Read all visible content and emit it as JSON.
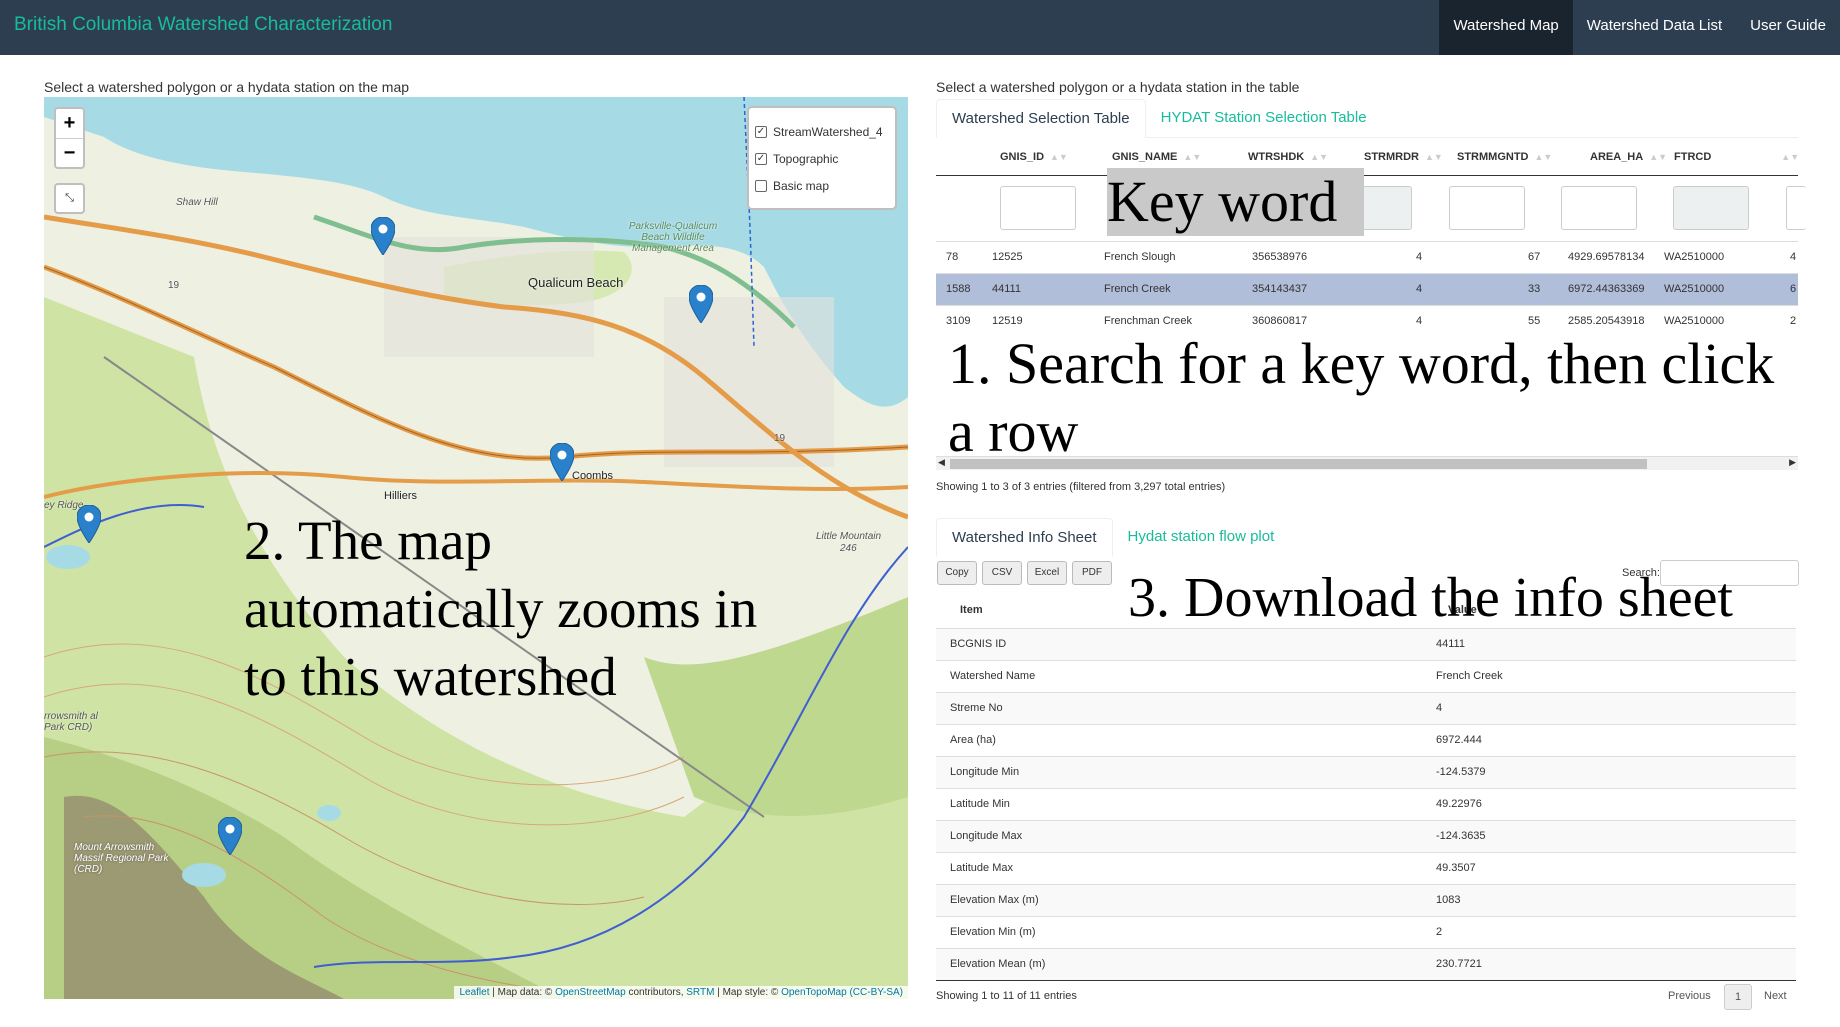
{
  "app": {
    "title": "British Columbia Watershed Characterization"
  },
  "nav": {
    "items": [
      "Watershed Map",
      "Watershed Data List",
      "User Guide"
    ]
  },
  "left": {
    "caption": "Select a watershed polygon or a hydata station on the map"
  },
  "right": {
    "caption": "Select a watershed polygon or a hydata station in the table"
  },
  "map": {
    "zoom_in": "+",
    "zoom_out": "−",
    "fullscreen": "⤡",
    "layers": [
      {
        "label": "StreamWatershed_4",
        "checked": true
      },
      {
        "label": "Topographic",
        "checked": true
      },
      {
        "label": "Basic map",
        "checked": false
      }
    ],
    "places": {
      "qualicum": "Qualicum Beach",
      "coombs": "Coombs",
      "hilliers": "Hilliers",
      "shaw": "Shaw Hill",
      "little_mountain": "Little Mountain",
      "little_mountain_elev": "246",
      "wildlife": "Parksville-Qualicum Beach Wildlife Management Area",
      "errington": "ey Ridge",
      "arrowsmith": "rrowsmith al Park CRD)",
      "mount_arrowsmith": "Mount Arrowsmith Massif Regional Park (CRD)",
      "hwy19a": "19",
      "hwy19b": "19"
    },
    "attribution": {
      "leaflet": "Leaflet",
      "sep1": " | Map data: © ",
      "osm": "OpenStreetMap",
      "contributors": " contributors, ",
      "srtm": "SRTM",
      "style": " | Map style: © ",
      "otm": "OpenTopoMap",
      "license": "(CC-BY-SA)"
    },
    "marker_color": "#2a81cb"
  },
  "selection_tabs": [
    "Watershed Selection Table",
    "HYDAT Station Selection Table"
  ],
  "selection_table": {
    "columns": [
      "GNIS_ID",
      "GNIS_NAME",
      "WTRSHDK",
      "STRMRDR",
      "STRMMGNTD",
      "AREA_HA",
      "FTRCD"
    ],
    "rows": [
      {
        "idx": "78",
        "id": "12525",
        "name": "French Slough",
        "wtr": "356538976",
        "ord": "4",
        "mag": "67",
        "area": "4929.69578134",
        "ft": "WA2510000",
        "extra": "4"
      },
      {
        "idx": "1588",
        "id": "44111",
        "name": "French Creek",
        "wtr": "354143437",
        "ord": "4",
        "mag": "33",
        "area": "6972.44363369",
        "ft": "WA2510000",
        "extra": "6"
      },
      {
        "idx": "3109",
        "id": "12519",
        "name": "Frenchman Creek",
        "wtr": "360860817",
        "ord": "4",
        "mag": "55",
        "area": "2585.20543918",
        "ft": "WA2510000",
        "extra": "2"
      }
    ],
    "info": "Showing 1 to 3 of 3 entries (filtered from 3,297 total entries)"
  },
  "info_tabs": [
    "Watershed Info Sheet",
    "Hydat station flow plot"
  ],
  "buttons": {
    "copy": "Copy",
    "csv": "CSV",
    "excel": "Excel",
    "pdf": "PDF"
  },
  "search_label": "Search:",
  "info_table": {
    "headers": [
      "Item",
      "Value"
    ],
    "rows": [
      [
        "BCGNIS ID",
        "44111"
      ],
      [
        "Watershed Name",
        "French Creek"
      ],
      [
        "Streme No",
        "4"
      ],
      [
        "Area (ha)",
        "6972.444"
      ],
      [
        "Longitude Min",
        "-124.5379"
      ],
      [
        "Latitude Min",
        "49.22976"
      ],
      [
        "Longitude Max",
        "-124.3635"
      ],
      [
        "Latitude Max",
        "49.3507"
      ],
      [
        "Elevation Max (m)",
        "1083"
      ],
      [
        "Elevation Min (m)",
        "2"
      ],
      [
        "Elevation Mean (m)",
        "230.7721"
      ]
    ],
    "info": "Showing 1 to 11 of 11 entries",
    "prev": "Previous",
    "page": "1",
    "next": "Next"
  },
  "annotations": {
    "keyword": "Key word",
    "step1": "1. Search for a key word, then click a row",
    "step2": "2. The map automatically zooms in to this watershed",
    "step3": "3. Download the info sheet"
  }
}
